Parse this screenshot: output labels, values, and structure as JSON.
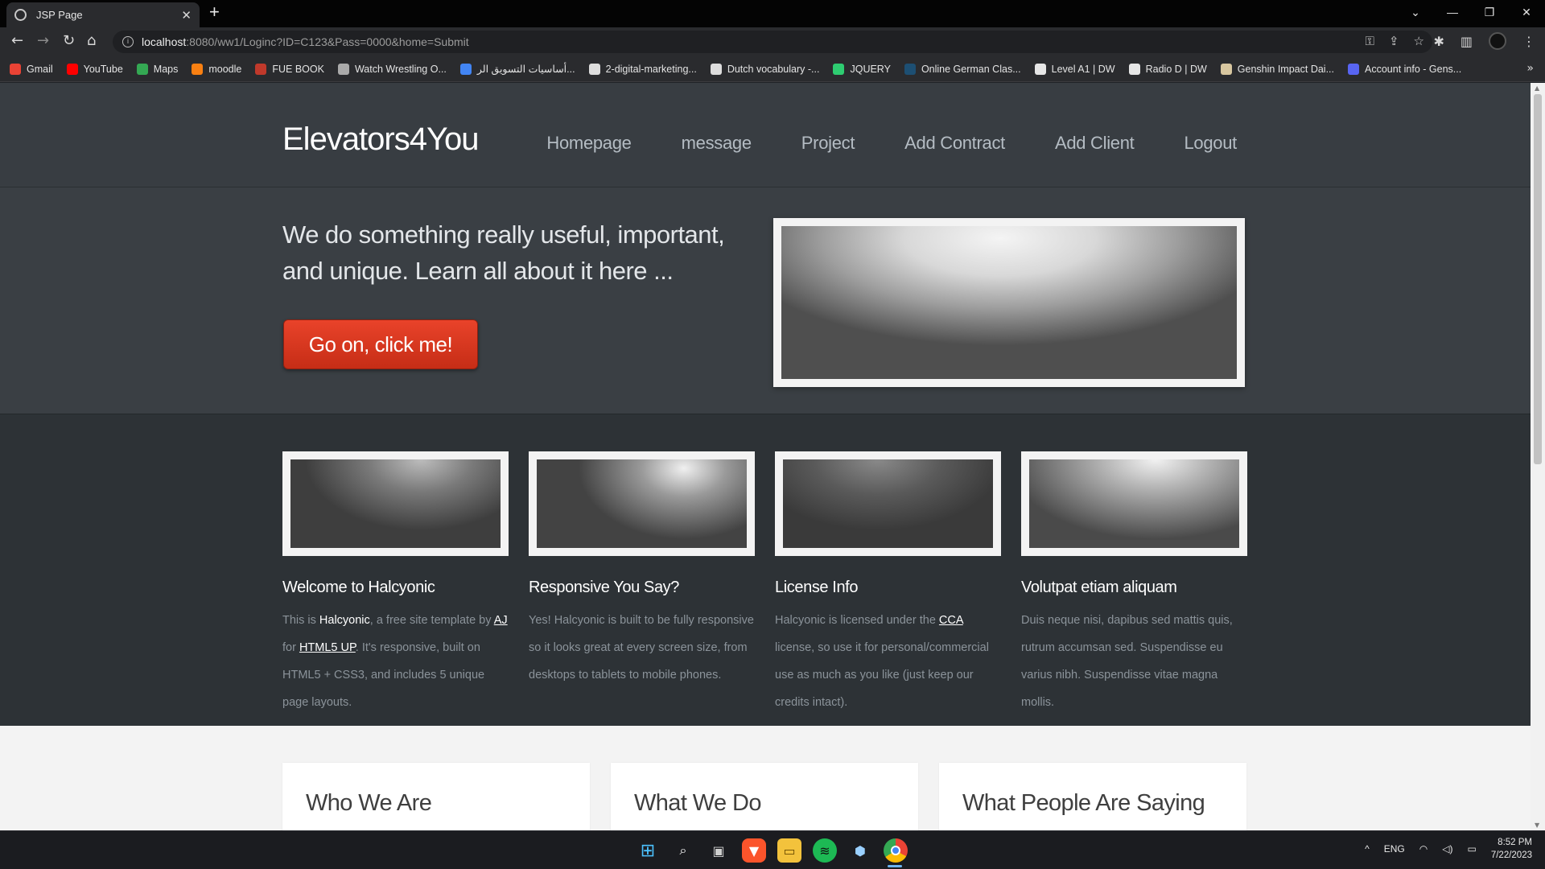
{
  "browser": {
    "tab_title": "JSP Page",
    "tab_close": "✕",
    "new_tab": "+",
    "url_host": "localhost",
    "url_path": ":8080/ww1/Loginc?ID=C123&Pass=0000&home=Submit",
    "window_controls": [
      "⌄",
      "—",
      "❐",
      "✕"
    ],
    "bookmarks": [
      {
        "label": "Gmail",
        "color": "#ea4335"
      },
      {
        "label": "YouTube",
        "color": "#ff0000"
      },
      {
        "label": "Maps",
        "color": "#34a853"
      },
      {
        "label": "moodle",
        "color": "#f98012"
      },
      {
        "label": "FUE BOOK",
        "color": "#c0392b"
      },
      {
        "label": "Watch Wrestling O...",
        "color": "#aaaaaa"
      },
      {
        "label": "أساسيات التسويق الر...",
        "color": "#4285f4"
      },
      {
        "label": "2-digital-marketing...",
        "color": "#dddddd"
      },
      {
        "label": "Dutch vocabulary -...",
        "color": "#dddddd"
      },
      {
        "label": "JQUERY",
        "color": "#2ecc71"
      },
      {
        "label": "Online German Clas...",
        "color": "#1d4f73"
      },
      {
        "label": "Level A1 | DW",
        "color": "#e6e6e6"
      },
      {
        "label": "Radio D | DW",
        "color": "#e6e6e6"
      },
      {
        "label": "Genshin Impact Dai...",
        "color": "#d8c7a0"
      },
      {
        "label": "Account info - Gens...",
        "color": "#5865f2"
      }
    ]
  },
  "site": {
    "logo": "Elevators4You",
    "nav": [
      "Homepage",
      "message",
      "Project",
      "Add Contract",
      "Add Client",
      "Logout"
    ],
    "banner_text": "We do something really useful, important, and unique. Learn all about it here ...",
    "cta_label": "Go on, click me!",
    "features": [
      {
        "title": "Welcome to Halcyonic",
        "body": [
          {
            "t": "This is ",
            "k": "text"
          },
          {
            "t": "Halcyonic",
            "k": "hl"
          },
          {
            "t": ", a free site template by ",
            "k": "text"
          },
          {
            "t": "AJ",
            "k": "link"
          },
          {
            "t": " for ",
            "k": "text"
          },
          {
            "t": "HTML5 UP",
            "k": "link"
          },
          {
            "t": ". It's responsive, built on HTML5 + CSS3, and includes 5 unique page layouts.",
            "k": "text"
          }
        ]
      },
      {
        "title": "Responsive You Say?",
        "body": [
          {
            "t": "Yes! Halcyonic is built to be fully responsive so it looks great at every screen size, from desktops to tablets to mobile phones.",
            "k": "text"
          }
        ]
      },
      {
        "title": "License Info",
        "body": [
          {
            "t": "Halcyonic is licensed under the ",
            "k": "text"
          },
          {
            "t": "CCA",
            "k": "link"
          },
          {
            "t": " license, so use it for personal/commercial use as much as you like (just keep our credits intact).",
            "k": "text"
          }
        ]
      },
      {
        "title": "Volutpat etiam aliquam",
        "body": [
          {
            "t": "Duis neque nisi, dapibus sed mattis quis, rutrum accumsan sed. Suspendisse eu varius nibh. Suspendisse vitae magna mollis.",
            "k": "text"
          }
        ]
      }
    ],
    "boxes": [
      "Who We Are",
      "What We Do",
      "What People Are Saying"
    ]
  },
  "taskbar": {
    "lang": "ENG",
    "time": "8:52 PM",
    "date": "7/22/2023"
  }
}
